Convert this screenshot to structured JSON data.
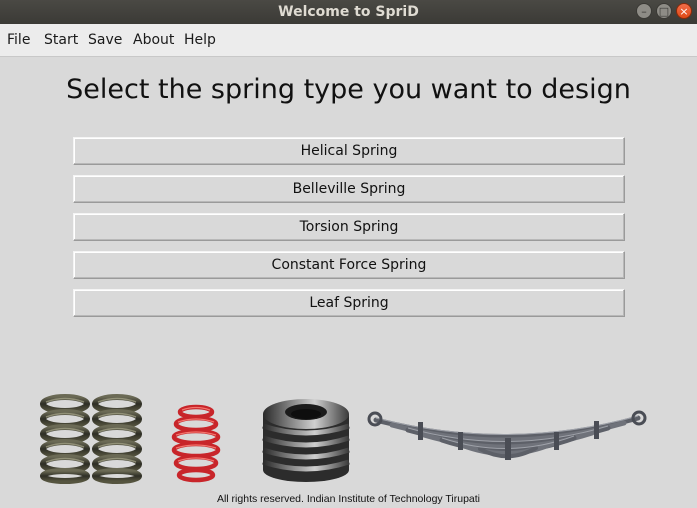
{
  "window": {
    "title": "Welcome to SpriD"
  },
  "menu": {
    "items": [
      {
        "label": "File"
      },
      {
        "label": "Start"
      },
      {
        "label": "Save"
      },
      {
        "label": "About"
      },
      {
        "label": "Help"
      }
    ]
  },
  "main": {
    "heading": "Select the spring type you want to design",
    "buttons": [
      {
        "label": "Helical Spring"
      },
      {
        "label": "Belleville Spring"
      },
      {
        "label": "Torsion Spring"
      },
      {
        "label": "Constant Force Spring"
      },
      {
        "label": "Leaf Spring"
      }
    ]
  },
  "images": [
    {
      "icon": "double-helical-spring-image"
    },
    {
      "icon": "red-helical-spring-image"
    },
    {
      "icon": "belleville-disc-spring-image"
    },
    {
      "icon": "leaf-spring-image"
    }
  ],
  "footer": {
    "text": "All rights reserved. Indian Institute of Technology Tirupati"
  },
  "colors": {
    "background": "#d9d9d9",
    "titlebar": "#3b3a36",
    "close_button": "#df4a16",
    "red_spring": "#c8252a"
  }
}
